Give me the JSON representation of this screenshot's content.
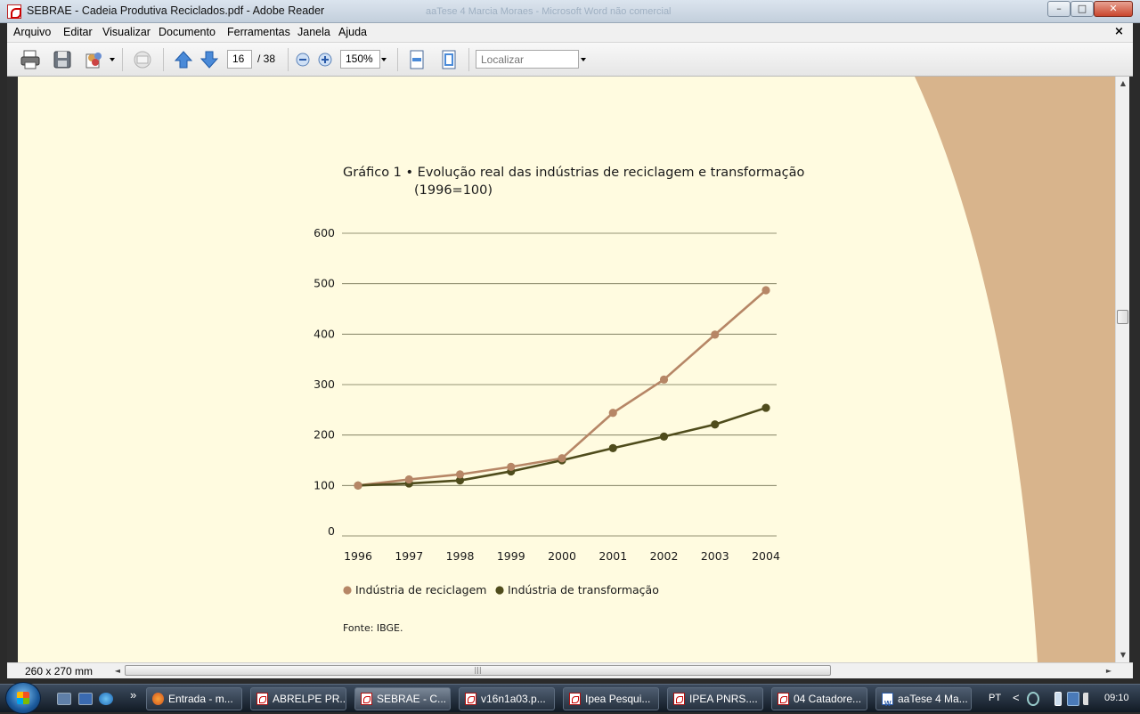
{
  "window": {
    "title": "SEBRAE - Cadeia Produtiva Reciclados.pdf - Adobe Reader",
    "background_title": "aaTese 4 Marcia Moraes - Microsoft Word não comercial",
    "controls": {
      "minimize": "–",
      "maximize": "□",
      "close": "✕"
    }
  },
  "menu": {
    "items": [
      "Arquivo",
      "Editar",
      "Visualizar",
      "Documento",
      "Ferramentas",
      "Janela",
      "Ajuda"
    ],
    "close_doc": "×"
  },
  "toolbar": {
    "current_page": "16",
    "page_total": "/ 38",
    "zoom": "150%",
    "search_placeholder": "Localizar"
  },
  "status": {
    "page_size": "260 x 270 mm",
    "hscroll_grip": "|||"
  },
  "document": {
    "chart_title_line1": "Gráfico 1 • Evolução real das indústrias de reciclagem e transformação",
    "chart_title_line2": "(1996=100)",
    "source": "Fonte: IBGE."
  },
  "colors": {
    "page": "#fffbe0",
    "decor": "#d8b48c",
    "series_reciclagem": "#b68666",
    "series_transformacao": "#4f4c1c",
    "grid": "#707050"
  },
  "chart_data": {
    "type": "line",
    "x": [
      "1996",
      "1997",
      "1998",
      "1999",
      "2000",
      "2001",
      "2002",
      "2003",
      "2004"
    ],
    "ylim": [
      0,
      600
    ],
    "yticks": [
      "0",
      "100",
      "200",
      "300",
      "400",
      "500",
      "600"
    ],
    "grid": true,
    "legend": "bottom",
    "series": [
      {
        "name": "Indústria de reciclagem",
        "color": "#b68666",
        "values": [
          100,
          112,
          122,
          137,
          154,
          244,
          310,
          399,
          487
        ]
      },
      {
        "name": "Indústria de transformação",
        "color": "#4f4c1c",
        "values": [
          100,
          104,
          110,
          128,
          150,
          174,
          197,
          221,
          254
        ]
      }
    ]
  },
  "taskbar": {
    "tasks": [
      {
        "label": "Entrada - m...",
        "icon": "firefox-icon"
      },
      {
        "label": "ABRELPE PR...",
        "icon": "pdf-icon"
      },
      {
        "label": "SEBRAE - C...",
        "icon": "pdf-icon",
        "active": true
      },
      {
        "label": "v16n1a03.p...",
        "icon": "pdf-icon"
      },
      {
        "label": "Ipea Pesqui...",
        "icon": "pdf-icon"
      },
      {
        "label": "IPEA PNRS....",
        "icon": "pdf-icon"
      },
      {
        "label": "04 Catadore...",
        "icon": "pdf-icon"
      },
      {
        "label": "aaTese 4 Ma...",
        "icon": "word-icon"
      }
    ],
    "language": "PT",
    "time": "09:10",
    "chevron": "»",
    "tray_expand": "<"
  }
}
